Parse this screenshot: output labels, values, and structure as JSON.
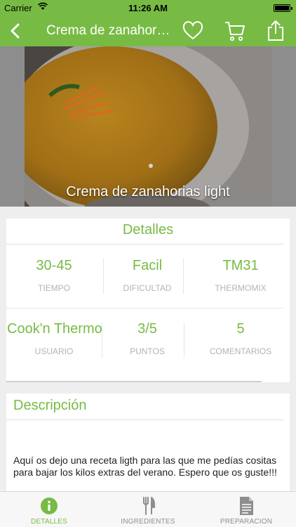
{
  "status_bar": {
    "carrier": "Carrier",
    "time": "11:26 AM"
  },
  "navbar": {
    "title": "Crema de zanahori…",
    "icons": [
      "chevron-left-icon",
      "heart-icon",
      "cart-icon",
      "share-icon"
    ]
  },
  "hero": {
    "title": "Crema de zanahorias light"
  },
  "details": {
    "title": "Detalles",
    "row1": [
      {
        "value": "30-45",
        "label": "TIEMPO"
      },
      {
        "value": "Facil",
        "label": "DIFICULTAD"
      },
      {
        "value": "TM31",
        "label": "THERMOMIX"
      }
    ],
    "row2": [
      {
        "value": "Cook'n Thermo",
        "label": "USUARIO"
      },
      {
        "value": "3/5",
        "label": "PUNTOS"
      },
      {
        "value": "5",
        "label": "COMENTARIOS"
      }
    ]
  },
  "description": {
    "title": "Descripción",
    "text": "Aquí os dejo una receta ligth para las que me pedías cositas para bajar los kilos extras del verano. Espero que os guste!!!"
  },
  "tabbar": {
    "tabs": [
      {
        "label": "DETALLES",
        "icon": "info-icon",
        "active": true
      },
      {
        "label": "INGREDIENTES",
        "icon": "fork-knife-icon",
        "active": false
      },
      {
        "label": "PREPARACION",
        "icon": "document-icon",
        "active": false
      }
    ]
  },
  "colors": {
    "accent": "#77bb44",
    "muted_label": "#b3b3b3",
    "tab_inactive": "#8e8e8e"
  }
}
